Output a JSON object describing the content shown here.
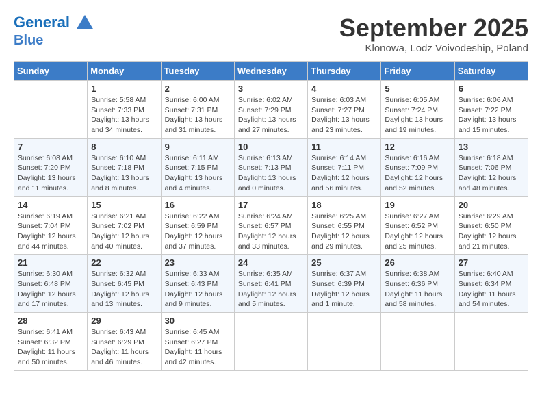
{
  "header": {
    "logo_line1": "General",
    "logo_line2": "Blue",
    "month": "September 2025",
    "location": "Klonowa, Lodz Voivodeship, Poland"
  },
  "days_of_week": [
    "Sunday",
    "Monday",
    "Tuesday",
    "Wednesday",
    "Thursday",
    "Friday",
    "Saturday"
  ],
  "weeks": [
    [
      {
        "num": "",
        "info": ""
      },
      {
        "num": "1",
        "info": "Sunrise: 5:58 AM\nSunset: 7:33 PM\nDaylight: 13 hours\nand 34 minutes."
      },
      {
        "num": "2",
        "info": "Sunrise: 6:00 AM\nSunset: 7:31 PM\nDaylight: 13 hours\nand 31 minutes."
      },
      {
        "num": "3",
        "info": "Sunrise: 6:02 AM\nSunset: 7:29 PM\nDaylight: 13 hours\nand 27 minutes."
      },
      {
        "num": "4",
        "info": "Sunrise: 6:03 AM\nSunset: 7:27 PM\nDaylight: 13 hours\nand 23 minutes."
      },
      {
        "num": "5",
        "info": "Sunrise: 6:05 AM\nSunset: 7:24 PM\nDaylight: 13 hours\nand 19 minutes."
      },
      {
        "num": "6",
        "info": "Sunrise: 6:06 AM\nSunset: 7:22 PM\nDaylight: 13 hours\nand 15 minutes."
      }
    ],
    [
      {
        "num": "7",
        "info": "Sunrise: 6:08 AM\nSunset: 7:20 PM\nDaylight: 13 hours\nand 11 minutes."
      },
      {
        "num": "8",
        "info": "Sunrise: 6:10 AM\nSunset: 7:18 PM\nDaylight: 13 hours\nand 8 minutes."
      },
      {
        "num": "9",
        "info": "Sunrise: 6:11 AM\nSunset: 7:15 PM\nDaylight: 13 hours\nand 4 minutes."
      },
      {
        "num": "10",
        "info": "Sunrise: 6:13 AM\nSunset: 7:13 PM\nDaylight: 13 hours\nand 0 minutes."
      },
      {
        "num": "11",
        "info": "Sunrise: 6:14 AM\nSunset: 7:11 PM\nDaylight: 12 hours\nand 56 minutes."
      },
      {
        "num": "12",
        "info": "Sunrise: 6:16 AM\nSunset: 7:09 PM\nDaylight: 12 hours\nand 52 minutes."
      },
      {
        "num": "13",
        "info": "Sunrise: 6:18 AM\nSunset: 7:06 PM\nDaylight: 12 hours\nand 48 minutes."
      }
    ],
    [
      {
        "num": "14",
        "info": "Sunrise: 6:19 AM\nSunset: 7:04 PM\nDaylight: 12 hours\nand 44 minutes."
      },
      {
        "num": "15",
        "info": "Sunrise: 6:21 AM\nSunset: 7:02 PM\nDaylight: 12 hours\nand 40 minutes."
      },
      {
        "num": "16",
        "info": "Sunrise: 6:22 AM\nSunset: 6:59 PM\nDaylight: 12 hours\nand 37 minutes."
      },
      {
        "num": "17",
        "info": "Sunrise: 6:24 AM\nSunset: 6:57 PM\nDaylight: 12 hours\nand 33 minutes."
      },
      {
        "num": "18",
        "info": "Sunrise: 6:25 AM\nSunset: 6:55 PM\nDaylight: 12 hours\nand 29 minutes."
      },
      {
        "num": "19",
        "info": "Sunrise: 6:27 AM\nSunset: 6:52 PM\nDaylight: 12 hours\nand 25 minutes."
      },
      {
        "num": "20",
        "info": "Sunrise: 6:29 AM\nSunset: 6:50 PM\nDaylight: 12 hours\nand 21 minutes."
      }
    ],
    [
      {
        "num": "21",
        "info": "Sunrise: 6:30 AM\nSunset: 6:48 PM\nDaylight: 12 hours\nand 17 minutes."
      },
      {
        "num": "22",
        "info": "Sunrise: 6:32 AM\nSunset: 6:45 PM\nDaylight: 12 hours\nand 13 minutes."
      },
      {
        "num": "23",
        "info": "Sunrise: 6:33 AM\nSunset: 6:43 PM\nDaylight: 12 hours\nand 9 minutes."
      },
      {
        "num": "24",
        "info": "Sunrise: 6:35 AM\nSunset: 6:41 PM\nDaylight: 12 hours\nand 5 minutes."
      },
      {
        "num": "25",
        "info": "Sunrise: 6:37 AM\nSunset: 6:39 PM\nDaylight: 12 hours\nand 1 minute."
      },
      {
        "num": "26",
        "info": "Sunrise: 6:38 AM\nSunset: 6:36 PM\nDaylight: 11 hours\nand 58 minutes."
      },
      {
        "num": "27",
        "info": "Sunrise: 6:40 AM\nSunset: 6:34 PM\nDaylight: 11 hours\nand 54 minutes."
      }
    ],
    [
      {
        "num": "28",
        "info": "Sunrise: 6:41 AM\nSunset: 6:32 PM\nDaylight: 11 hours\nand 50 minutes."
      },
      {
        "num": "29",
        "info": "Sunrise: 6:43 AM\nSunset: 6:29 PM\nDaylight: 11 hours\nand 46 minutes."
      },
      {
        "num": "30",
        "info": "Sunrise: 6:45 AM\nSunset: 6:27 PM\nDaylight: 11 hours\nand 42 minutes."
      },
      {
        "num": "",
        "info": ""
      },
      {
        "num": "",
        "info": ""
      },
      {
        "num": "",
        "info": ""
      },
      {
        "num": "",
        "info": ""
      }
    ]
  ]
}
